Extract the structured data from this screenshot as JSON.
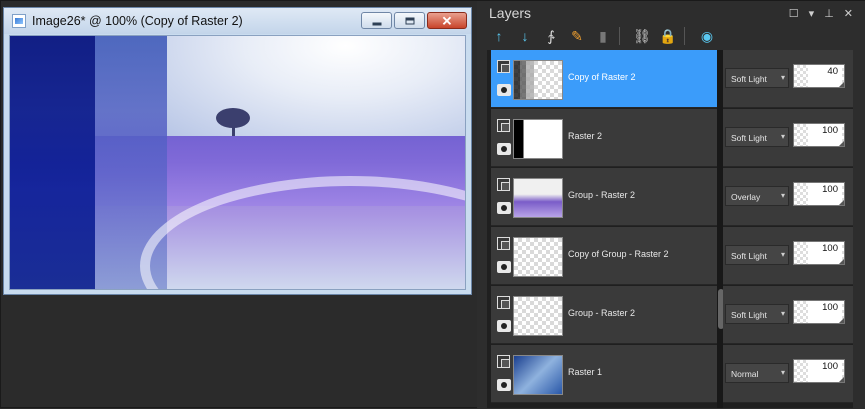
{
  "image_window": {
    "title": "Image26* @ 100% (Copy of Raster 2)",
    "close_glyph": "✕"
  },
  "layers_palette": {
    "title": "Layers",
    "header_controls": [
      "☐",
      "▾",
      "⊥",
      "✕"
    ],
    "toolbar_icons": [
      {
        "name": "new-raster-layer-icon",
        "glyph": "↑",
        "color": "#5ac8f0"
      },
      {
        "name": "new-vector-layer-icon",
        "glyph": "↓",
        "color": "#5ac8f0"
      },
      {
        "name": "new-mask-layer-icon",
        "glyph": "∱",
        "color": "#e0e0e0"
      },
      {
        "name": "layer-properties-icon",
        "glyph": "✎",
        "color": "#f0a030"
      },
      {
        "name": "delete-layer-icon",
        "glyph": "▮",
        "color": "#777777"
      },
      {
        "name": "link-icon",
        "glyph": "⛓",
        "color": "#d8d8d8"
      },
      {
        "name": "lock-icon",
        "glyph": "🔒",
        "color": "#f0c040"
      },
      {
        "name": "visibility-toggle-icon",
        "glyph": "◉",
        "color": "#5ac8f0"
      }
    ],
    "layers": [
      {
        "name": "Copy of Raster 2",
        "blend": "Soft Light",
        "opacity": "40",
        "selected": true,
        "thumb": "t-copy"
      },
      {
        "name": "Raster 2",
        "blend": "Soft Light",
        "opacity": "100",
        "selected": false,
        "thumb": "t-black"
      },
      {
        "name": "Group - Raster 2",
        "blend": "Overlay",
        "opacity": "100",
        "selected": false,
        "thumb": "t-group"
      },
      {
        "name": "Copy of Group - Raster 2",
        "blend": "Soft Light",
        "opacity": "100",
        "selected": false,
        "thumb": "t-trans"
      },
      {
        "name": "Group - Raster 2",
        "blend": "Soft Light",
        "opacity": "100",
        "selected": false,
        "thumb": "t-trans"
      },
      {
        "name": "Raster 1",
        "blend": "Normal",
        "opacity": "100",
        "selected": false,
        "thumb": "t-raster1"
      }
    ]
  }
}
